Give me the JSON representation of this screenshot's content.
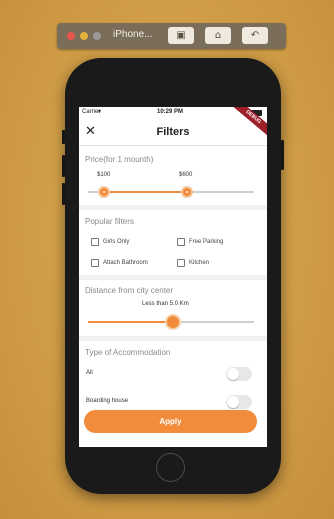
{
  "simulator": {
    "title": "iPhone...",
    "buttons": [
      "screenshot-icon",
      "home-icon",
      "rotate-icon"
    ]
  },
  "status_bar": {
    "carrier": "Carrier",
    "time": "10:29 PM",
    "ribbon": "DEBUG"
  },
  "nav": {
    "close_icon": "close-icon",
    "title": "Filters"
  },
  "price": {
    "title": "Price(for 1 mounth)",
    "min_label": "$100",
    "max_label": "$600",
    "range_fraction": [
      0.1,
      0.5
    ]
  },
  "popular_filters": {
    "title": "Popular filters",
    "items": [
      "Girls Only",
      "Free Parking",
      "Attach Bathroom",
      "Kitchen"
    ],
    "checked": [
      false,
      false,
      false,
      false
    ]
  },
  "distance": {
    "title": "Distance from city center",
    "value_label": "Less than 5.0 Km",
    "fraction": 0.5
  },
  "accommodation": {
    "title": "Type of Accommodation",
    "options": [
      {
        "label": "All",
        "on": false
      },
      {
        "label": "Boarding house",
        "on": false
      }
    ]
  },
  "apply_label": "Apply",
  "colors": {
    "accent": "#f28c3b",
    "background": "#d4a24d",
    "phone": "#1a1a1a"
  }
}
